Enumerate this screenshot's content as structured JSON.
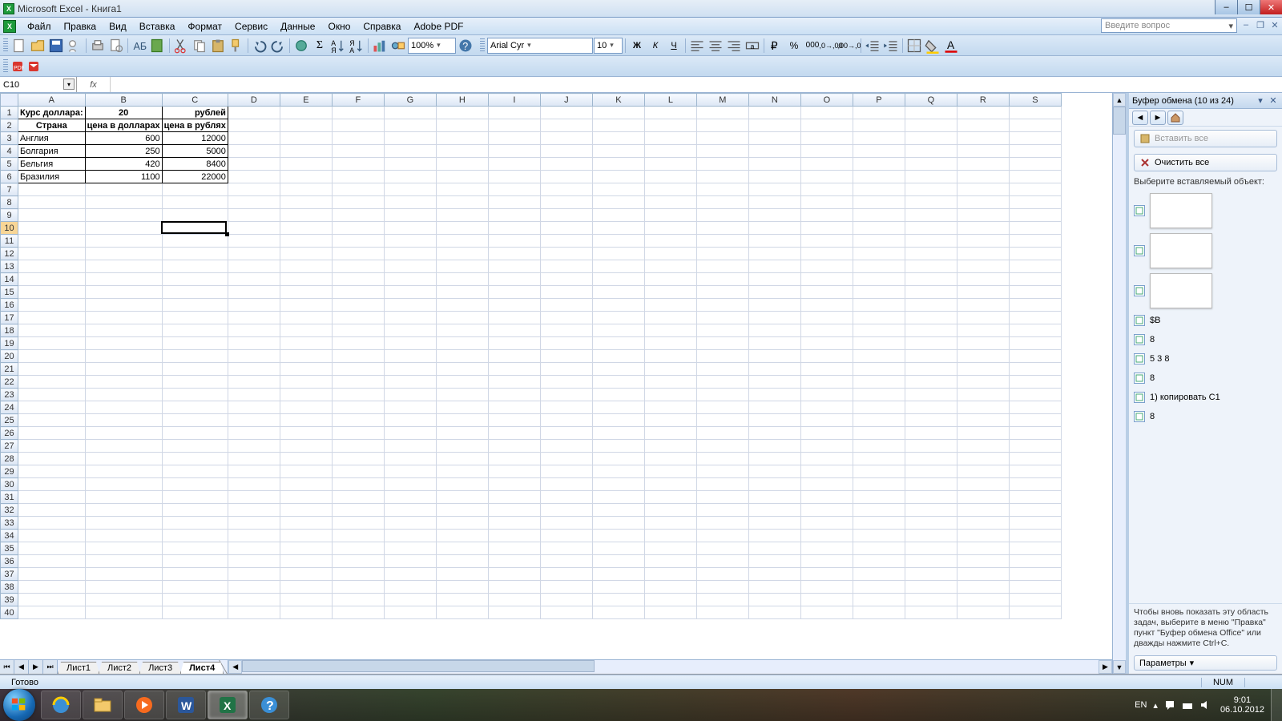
{
  "titlebar": {
    "text": "Microsoft Excel - Книга1"
  },
  "menubar": {
    "items": [
      "Файл",
      "Правка",
      "Вид",
      "Вставка",
      "Формат",
      "Сервис",
      "Данные",
      "Окно",
      "Справка",
      "Adobe PDF"
    ],
    "ask_placeholder": "Введите вопрос"
  },
  "toolbar": {
    "zoom": "100%",
    "font": "Arial Cyr",
    "fontsize": "10"
  },
  "namebox": "C10",
  "formula": "",
  "columns": [
    "A",
    "B",
    "C",
    "D",
    "E",
    "F",
    "G",
    "H",
    "I",
    "J",
    "K",
    "L",
    "M",
    "N",
    "O",
    "P",
    "Q",
    "R",
    "S"
  ],
  "row_count": 40,
  "active_cell": {
    "row": 10,
    "col": "C"
  },
  "data": {
    "r1": {
      "A": "Курс доллара:",
      "B": "20",
      "C": "рублей"
    },
    "r2": {
      "A": "Страна",
      "B": "цена в долларах",
      "C": "цена в рублях"
    },
    "r3": {
      "A": "Англия",
      "B": "600",
      "C": "12000"
    },
    "r4": {
      "A": "Болгария",
      "B": "250",
      "C": "5000"
    },
    "r5": {
      "A": "Бельгия",
      "B": "420",
      "C": "8400"
    },
    "r6": {
      "A": "Бразилия",
      "B": "1100",
      "C": "22000"
    }
  },
  "sheets": [
    "Лист1",
    "Лист2",
    "Лист3",
    "Лист4"
  ],
  "active_sheet": "Лист4",
  "statusbar": {
    "ready": "Готово",
    "num": "NUM"
  },
  "taskpane": {
    "title": "Буфер обмена (10 из 24)",
    "paste_all": "Вставить все",
    "clear_all": "Очистить все",
    "choose_label": "Выберите вставляемый объект:",
    "items": [
      {
        "type": "preview"
      },
      {
        "type": "preview"
      },
      {
        "type": "preview"
      },
      {
        "type": "text",
        "text": "$B"
      },
      {
        "type": "text",
        "text": "8"
      },
      {
        "type": "text",
        "text": "5 3 8"
      },
      {
        "type": "text",
        "text": "8"
      },
      {
        "type": "text",
        "text": "1) копировать С1"
      },
      {
        "type": "text",
        "text": "8"
      }
    ],
    "footer": "Чтобы вновь показать эту область задач, выберите в меню \"Правка\" пункт \"Буфер обмена Office\" или дважды нажмите Ctrl+C.",
    "options": "Параметры"
  },
  "tray": {
    "lang": "EN",
    "time": "9:01",
    "date": "06.10.2012"
  }
}
